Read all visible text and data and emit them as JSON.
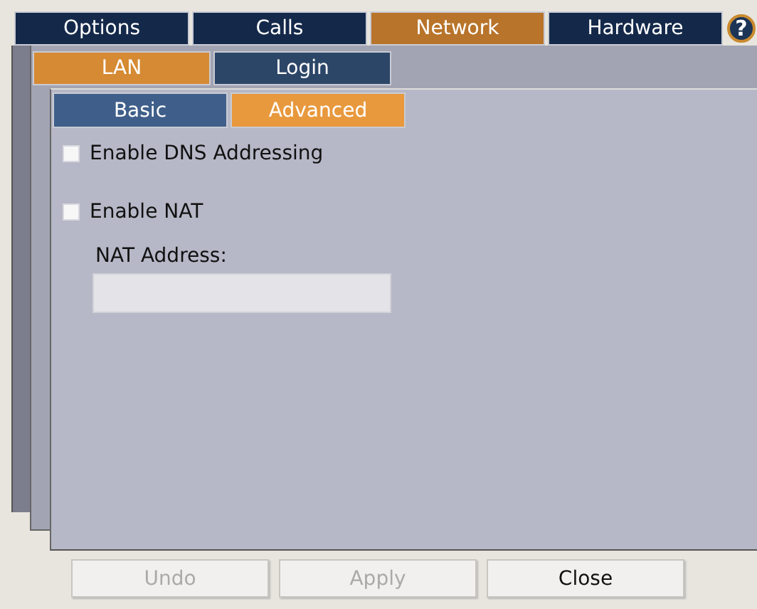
{
  "main_tabs": [
    {
      "label": "Options",
      "selected": false
    },
    {
      "label": "Calls",
      "selected": false
    },
    {
      "label": "Network",
      "selected": true
    },
    {
      "label": "Hardware",
      "selected": false
    }
  ],
  "help_button": "?",
  "section_tabs": [
    {
      "label": "LAN",
      "selected": true
    },
    {
      "label": "Login",
      "selected": false
    }
  ],
  "mode_tabs": [
    {
      "label": "Basic",
      "selected": false
    },
    {
      "label": "Advanced",
      "selected": true
    }
  ],
  "options": [
    {
      "label": "Enable DNS Addressing",
      "checked": false
    },
    {
      "label": "Enable NAT",
      "checked": false
    }
  ],
  "nat_address": {
    "label": "NAT Address:"
  },
  "buttons": [
    {
      "label": "Undo",
      "disabled": true
    },
    {
      "label": "Apply",
      "disabled": true
    },
    {
      "label": "Close",
      "disabled": false
    }
  ]
}
